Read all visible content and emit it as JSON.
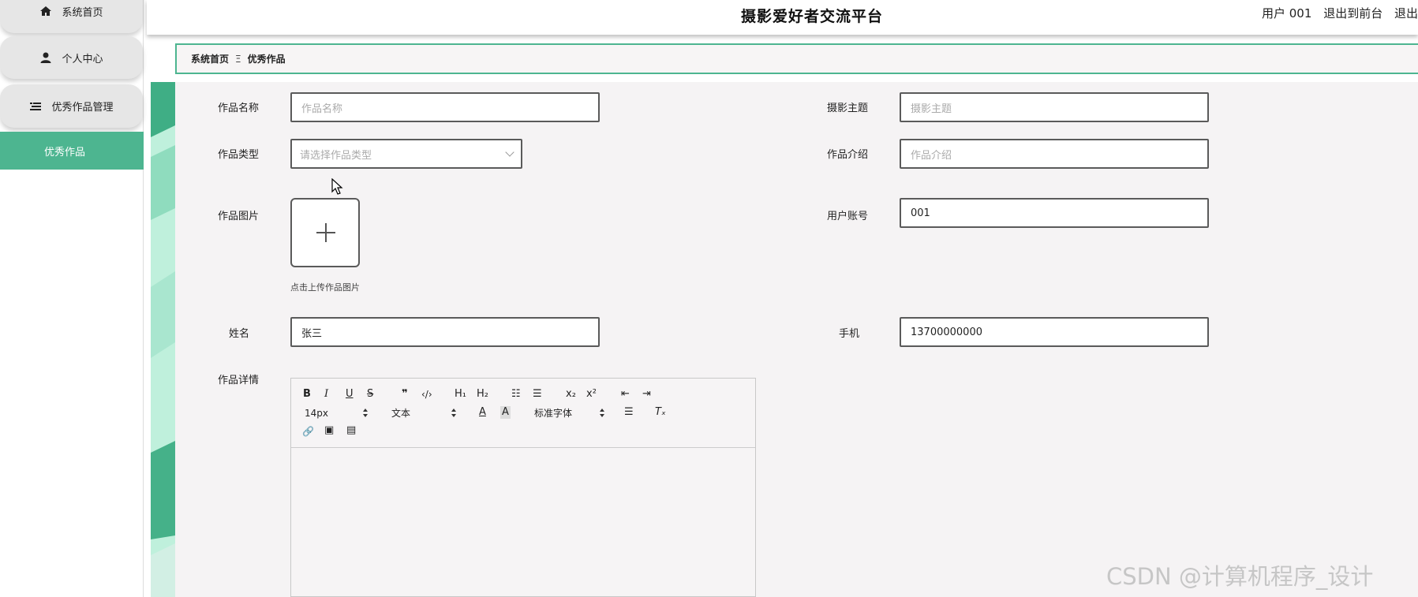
{
  "app": {
    "title": "摄影爱好者交流平台"
  },
  "header": {
    "user_label": "用户 001",
    "to_front_label": "退出到前台",
    "logout_label": "退出"
  },
  "sidebar": {
    "items": [
      {
        "label": "系统首页",
        "icon": "home-icon"
      },
      {
        "label": "个人中心",
        "icon": "user-icon"
      },
      {
        "label": "优秀作品管理",
        "icon": "list-icon"
      },
      {
        "label": "优秀作品",
        "icon": ""
      }
    ]
  },
  "breadcrumb": {
    "home": "系统首页",
    "separator": "Ξ",
    "current": "优秀作品"
  },
  "form": {
    "work_name": {
      "label": "作品名称",
      "placeholder": "作品名称",
      "value": ""
    },
    "theme": {
      "label": "摄影主题",
      "placeholder": "摄影主题",
      "value": ""
    },
    "work_type": {
      "label": "作品类型",
      "placeholder": "请选择作品类型"
    },
    "intro": {
      "label": "作品介绍",
      "placeholder": "作品介绍",
      "value": ""
    },
    "image": {
      "label": "作品图片",
      "hint": "点击上传作品图片"
    },
    "account": {
      "label": "用户账号",
      "value": "001"
    },
    "name": {
      "label": "姓名",
      "value": "张三"
    },
    "phone": {
      "label": "手机",
      "value": "13700000000"
    },
    "detail": {
      "label": "作品详情"
    }
  },
  "editor": {
    "font_size": "14px",
    "paragraph": "文本",
    "font_family": "标准字体",
    "buttons": {
      "bold": "B",
      "italic": "I",
      "underline": "U",
      "strike": "S",
      "quote": "❞",
      "code": "‹/›",
      "h1": "H₁",
      "h2": "H₂",
      "ordered_list": "☷",
      "bullet_list": "☰",
      "subscript": "x₂",
      "superscript": "x²",
      "outdent": "⇤",
      "indent": "⇥",
      "font_color": "A",
      "bg_color": "A",
      "align": "☰",
      "clear": "Tₓ",
      "link": "🔗",
      "image": "▣",
      "video": "▤"
    }
  },
  "watermark": "CSDN @计算机程序_设计",
  "colors": {
    "accent": "#4db590",
    "sidebar_item_bg": "#e6e6e6",
    "content_bg": "#f5f3f4"
  }
}
